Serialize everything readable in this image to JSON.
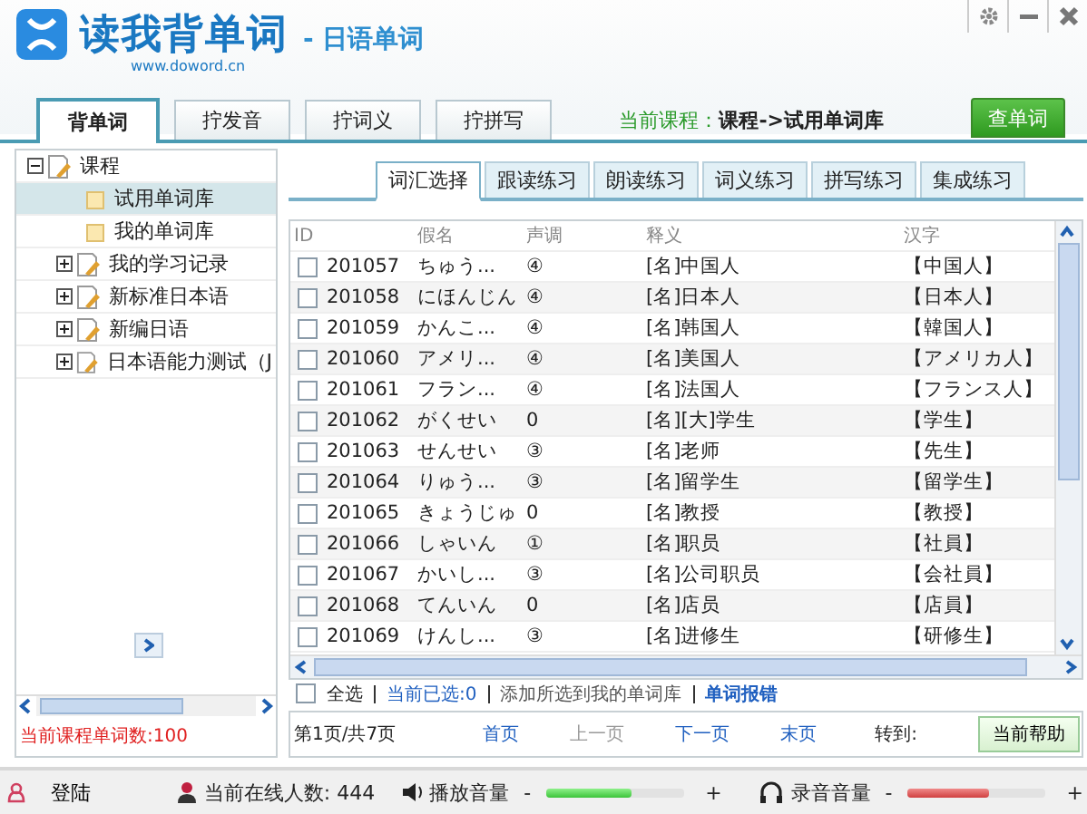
{
  "app": {
    "title": "读我背单词",
    "subtitle": "- 日语单词",
    "url": "www.doword.cn"
  },
  "main_tabs": [
    {
      "label": "背单词",
      "selected": true
    },
    {
      "label": "拧发音",
      "selected": false
    },
    {
      "label": "拧词义",
      "selected": false
    },
    {
      "label": "拧拼写",
      "selected": false
    }
  ],
  "current_course": {
    "label": "当前课程：",
    "value": "课程->试用单词库"
  },
  "lookup_button": "查单词",
  "tree": [
    {
      "label": "课程",
      "kind": "group",
      "expanded": true,
      "selected": false,
      "children": [
        {
          "label": "试用单词库",
          "kind": "leaf",
          "selected": true
        },
        {
          "label": "我的单词库",
          "kind": "leaf",
          "selected": false
        },
        {
          "label": "我的学习记录",
          "kind": "group",
          "expanded": false,
          "selected": false
        },
        {
          "label": "新标准日本语",
          "kind": "group",
          "expanded": false,
          "selected": false
        },
        {
          "label": "新编日语",
          "kind": "group",
          "expanded": false,
          "selected": false
        },
        {
          "label": "日本语能力测试（J",
          "kind": "group",
          "expanded": false,
          "selected": false
        }
      ]
    }
  ],
  "course_word_count": "当前课程单词数:100",
  "practice_tabs": [
    {
      "label": "词汇选择",
      "selected": true
    },
    {
      "label": "跟读练习",
      "selected": false
    },
    {
      "label": "朗读练习",
      "selected": false
    },
    {
      "label": "词义练习",
      "selected": false
    },
    {
      "label": "拼写练习",
      "selected": false
    },
    {
      "label": "集成练习",
      "selected": false
    }
  ],
  "table": {
    "columns": [
      "ID",
      "假名",
      "声调",
      "释义",
      "汉字"
    ],
    "rows": [
      {
        "checked": false,
        "id": "201057",
        "kana": "ちゅう...",
        "tone": "④",
        "meaning": "[名]中国人",
        "kanji": "【中国人】"
      },
      {
        "checked": false,
        "id": "201058",
        "kana": "にほんじん",
        "tone": "④",
        "meaning": "[名]日本人",
        "kanji": "【日本人】"
      },
      {
        "checked": false,
        "id": "201059",
        "kana": "かんこ...",
        "tone": "④",
        "meaning": "[名]韩国人",
        "kanji": "【韓国人】"
      },
      {
        "checked": false,
        "id": "201060",
        "kana": "アメリ...",
        "tone": "④",
        "meaning": "[名]美国人",
        "kanji": "【アメリカ人】"
      },
      {
        "checked": false,
        "id": "201061",
        "kana": "フラン...",
        "tone": "④",
        "meaning": "[名]法国人",
        "kanji": "【フランス人】"
      },
      {
        "checked": false,
        "id": "201062",
        "kana": "がくせい",
        "tone": "0",
        "meaning": "[名][大]学生",
        "kanji": "【学生】"
      },
      {
        "checked": false,
        "id": "201063",
        "kana": "せんせい",
        "tone": "③",
        "meaning": "[名]老师",
        "kanji": "【先生】"
      },
      {
        "checked": false,
        "id": "201064",
        "kana": "りゅう...",
        "tone": "③",
        "meaning": "[名]留学生",
        "kanji": "【留学生】"
      },
      {
        "checked": false,
        "id": "201065",
        "kana": "きょうじゅ",
        "tone": "0",
        "meaning": "[名]教授",
        "kanji": "【教授】"
      },
      {
        "checked": false,
        "id": "201066",
        "kana": "しゃいん",
        "tone": "①",
        "meaning": "[名]职员",
        "kanji": "【社員】"
      },
      {
        "checked": false,
        "id": "201067",
        "kana": "かいし...",
        "tone": "③",
        "meaning": "[名]公司职员",
        "kanji": "【会社員】"
      },
      {
        "checked": false,
        "id": "201068",
        "kana": "てんいん",
        "tone": "0",
        "meaning": "[名]店员",
        "kanji": "【店員】"
      },
      {
        "checked": false,
        "id": "201069",
        "kana": "けんし...",
        "tone": "③",
        "meaning": "[名]进修生",
        "kanji": "【研修生】"
      }
    ]
  },
  "table_actions": {
    "select_all": {
      "label": "全选",
      "checked": false
    },
    "selected_count": "当前已选:0",
    "add_to_list": "添加所选到我的单词库",
    "report_error": "单词报错"
  },
  "pagination": {
    "page_info": "第1页/共7页",
    "links": [
      {
        "label": "首页",
        "disabled": false
      },
      {
        "label": "上一页",
        "disabled": true
      },
      {
        "label": "下一页",
        "disabled": false
      },
      {
        "label": "末页",
        "disabled": false
      }
    ],
    "goto_label": "转到:",
    "help_button": "当前帮助"
  },
  "status_bar": {
    "login": "登陆",
    "online_users": "当前在线人数: 444",
    "sliders": [
      {
        "kind": "playback",
        "label": "播放音量",
        "minus": "-",
        "plus": "+",
        "level": 0.62
      },
      {
        "kind": "record",
        "label": "录音音量",
        "minus": "-",
        "plus": "+",
        "level": 0.6
      }
    ]
  }
}
